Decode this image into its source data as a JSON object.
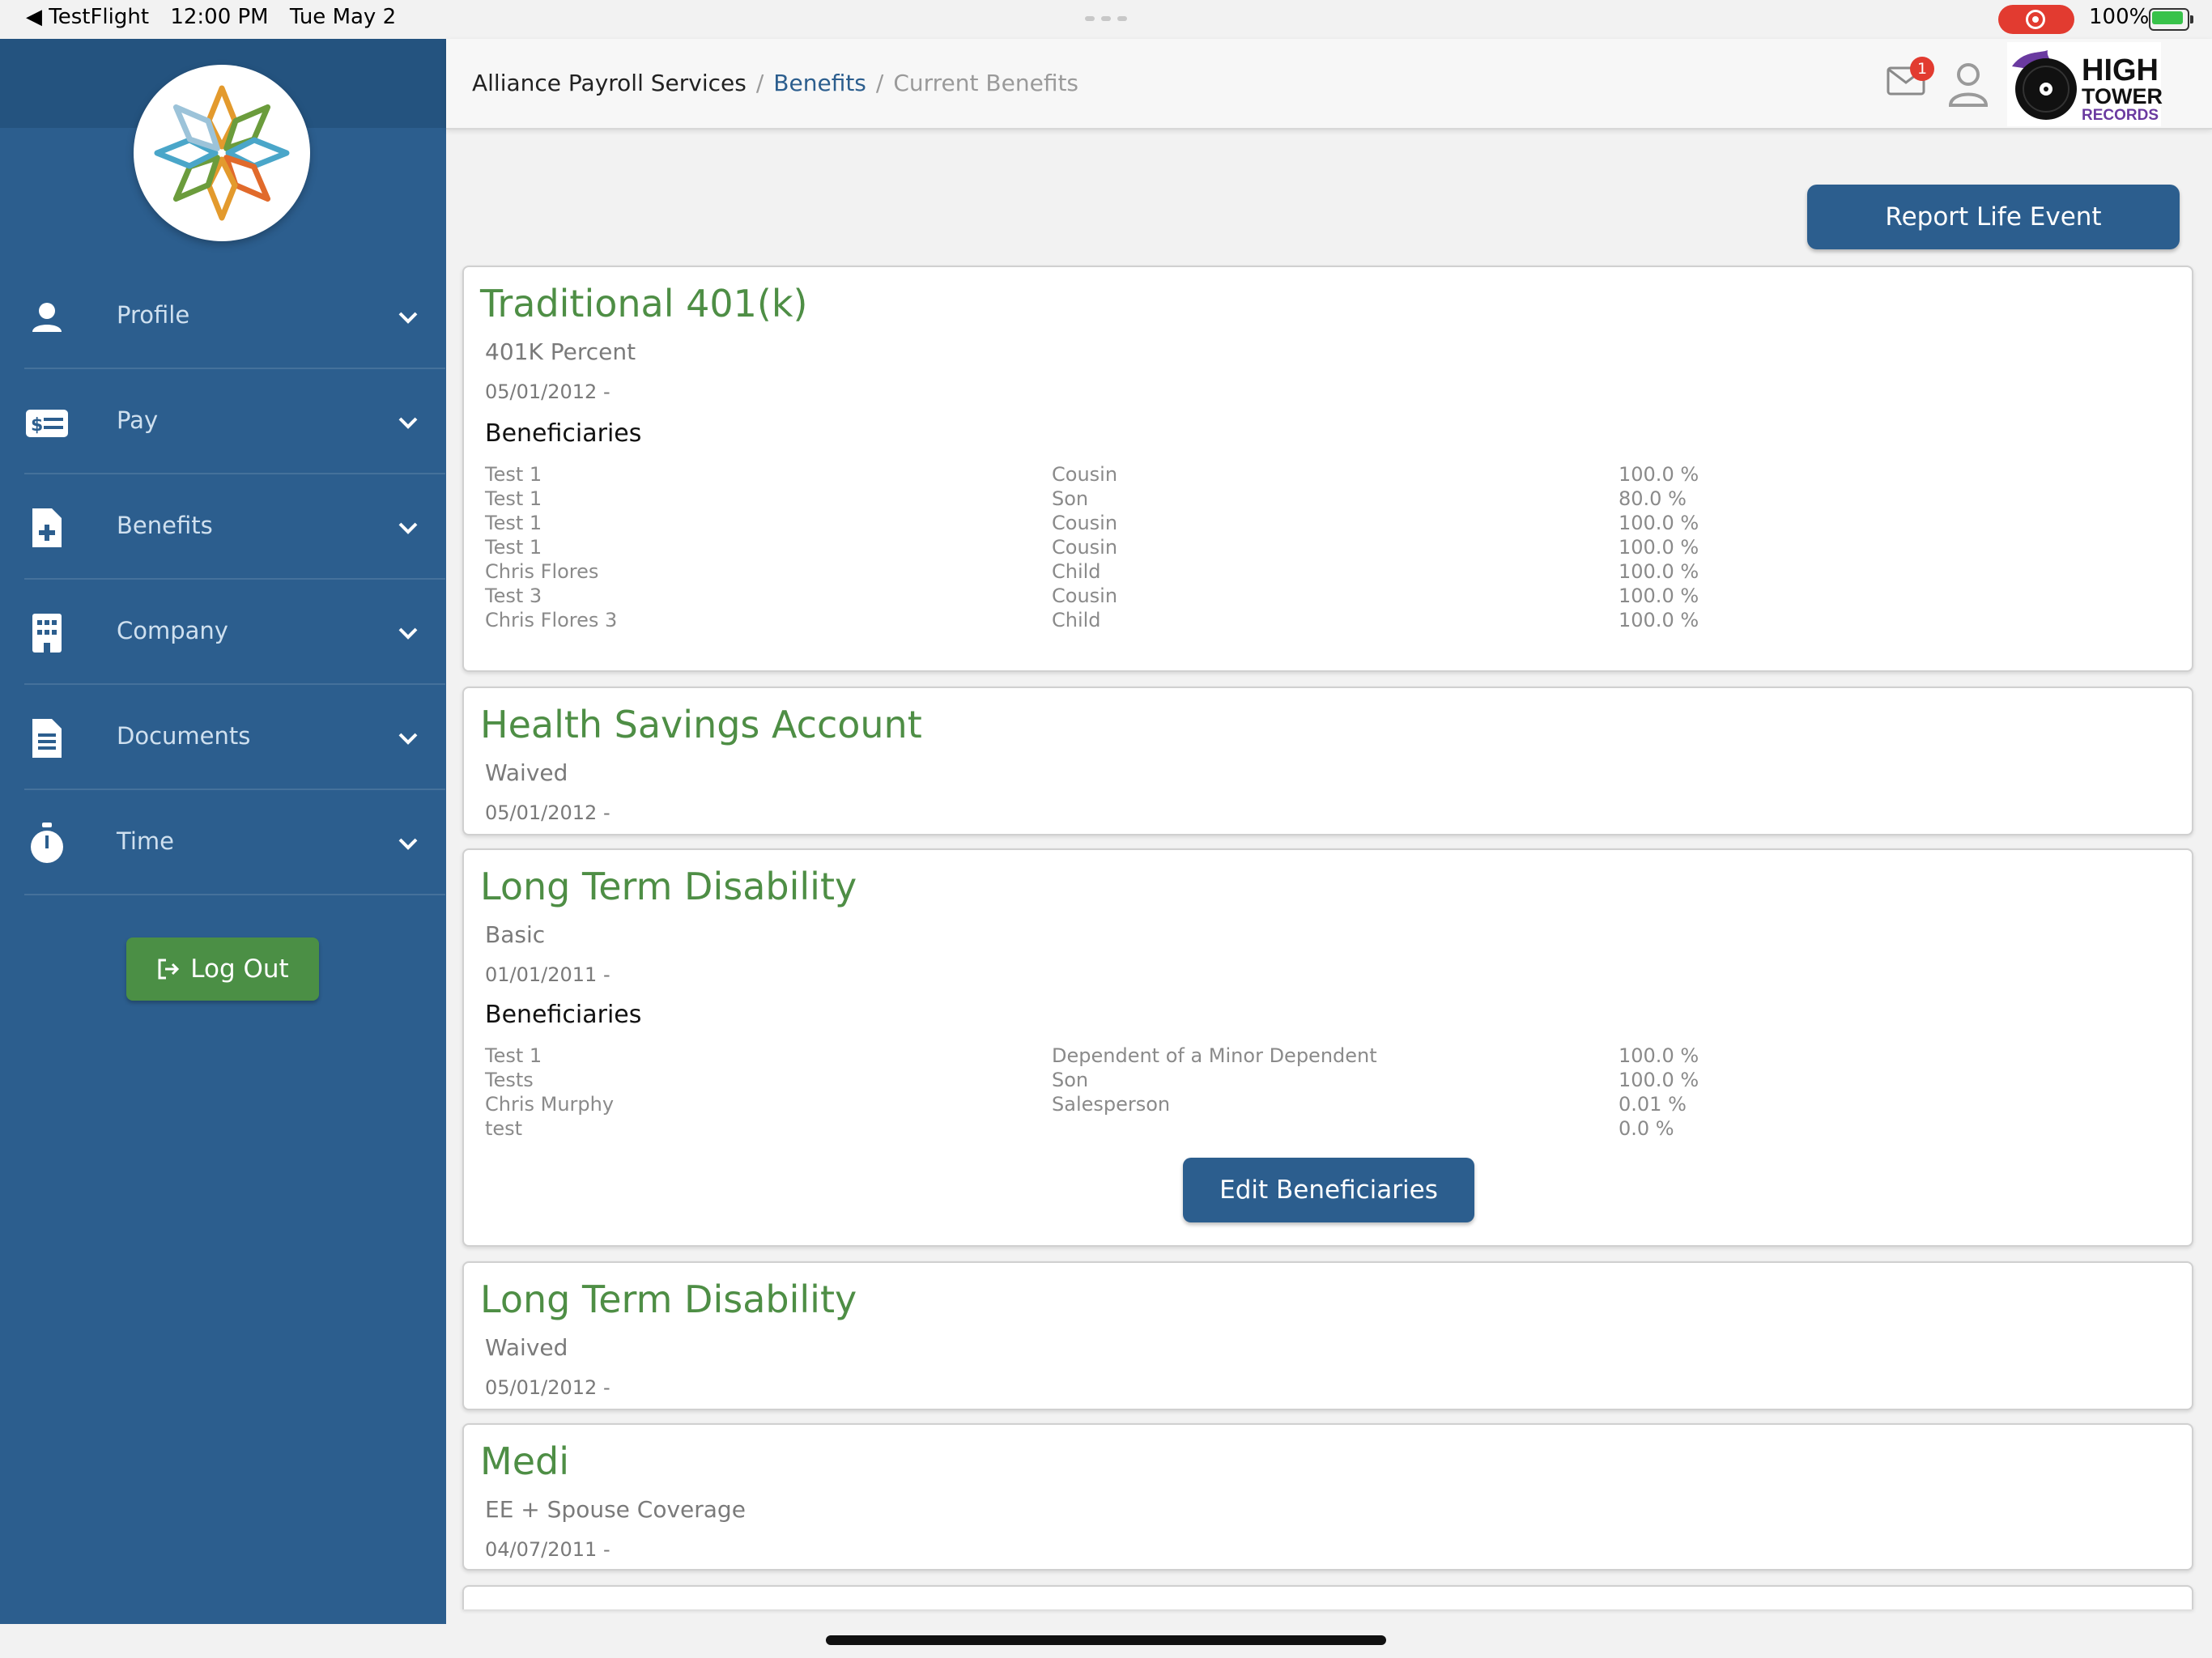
{
  "status_bar": {
    "back_app": "TestFlight",
    "time": "12:00 PM",
    "date": "Tue May 2",
    "battery": "100%"
  },
  "sidebar": {
    "items": [
      {
        "label": "Profile",
        "icon": "person-icon"
      },
      {
        "label": "Pay",
        "icon": "pay-card-icon"
      },
      {
        "label": "Benefits",
        "icon": "medical-document-icon"
      },
      {
        "label": "Company",
        "icon": "building-icon"
      },
      {
        "label": "Documents",
        "icon": "documents-icon"
      },
      {
        "label": "Time",
        "icon": "stopwatch-icon"
      }
    ],
    "logout_label": "Log Out"
  },
  "header": {
    "breadcrumb": {
      "home": "Alliance Payroll Services",
      "section": "Benefits",
      "current": "Current Benefits",
      "separator": "/"
    },
    "mail_badge": "1",
    "brand": {
      "line1": "HIGH",
      "line2": "TOWER",
      "line3": "RECORDS"
    }
  },
  "main": {
    "report_button": "Report Life Event",
    "edit_button": "Edit Beneficiaries",
    "beneficiaries_heading": "Beneficiaries",
    "cards": [
      {
        "title": "Traditional 401(k)",
        "plan": "401K Percent",
        "date": "05/01/2012 -",
        "beneficiaries": [
          {
            "name": "Test 1",
            "relation": "Cousin",
            "percent": "100.0 %"
          },
          {
            "name": "Test 1",
            "relation": "Son",
            "percent": "80.0 %"
          },
          {
            "name": "Test 1",
            "relation": "Cousin",
            "percent": "100.0 %"
          },
          {
            "name": "Test 1",
            "relation": "Cousin",
            "percent": "100.0 %"
          },
          {
            "name": "Chris Flores",
            "relation": "Child",
            "percent": "100.0 %"
          },
          {
            "name": "Test 3",
            "relation": "Cousin",
            "percent": "100.0 %"
          },
          {
            "name": "Chris Flores 3",
            "relation": "Child",
            "percent": "100.0 %"
          }
        ]
      },
      {
        "title": "Health Savings Account",
        "plan": "Waived",
        "date": "05/01/2012 -"
      },
      {
        "title": "Long Term Disability",
        "plan": "Basic",
        "date": "01/01/2011 -",
        "beneficiaries": [
          {
            "name": "Test 1",
            "relation": "Dependent of a Minor Dependent",
            "percent": "100.0 %"
          },
          {
            "name": "Tests",
            "relation": "Son",
            "percent": "100.0 %"
          },
          {
            "name": "Chris Murphy",
            "relation": "Salesperson",
            "percent": "0.01 %"
          },
          {
            "name": "test",
            "relation": "",
            "percent": "0.0 %"
          }
        ]
      },
      {
        "title": "Long Term Disability",
        "plan": "Waived",
        "date": "05/01/2012 -"
      },
      {
        "title": "Medi",
        "plan": "EE + Spouse Coverage",
        "date": "04/07/2011 -"
      }
    ]
  },
  "colors": {
    "sidebar": "#2c5e8e",
    "accent_green": "#4e8e45",
    "button_blue": "#2c5e8e",
    "badge_red": "#e23b30"
  }
}
